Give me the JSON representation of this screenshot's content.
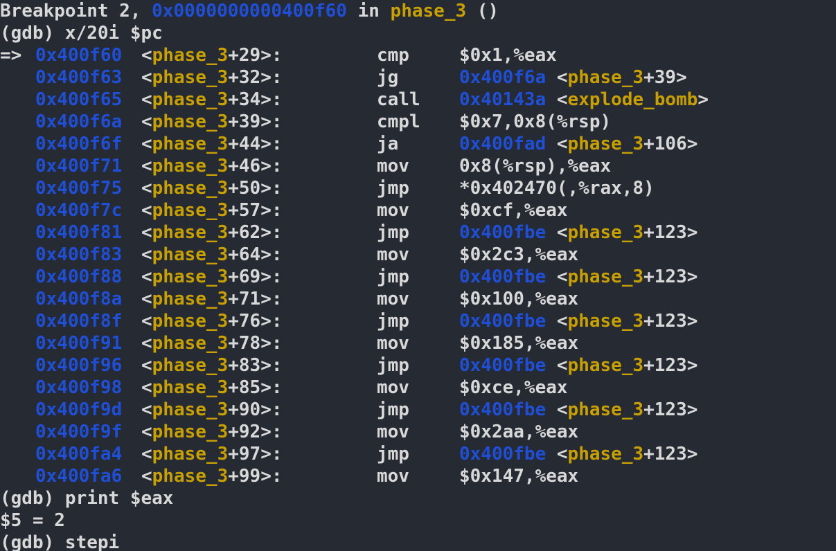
{
  "breakpoint": {
    "prefix": "Breakpoint 2, ",
    "address": "0x0000000000400f60",
    "in_text": " in ",
    "function": "phase_3",
    "suffix": " ()"
  },
  "command1": "(gdb) x/20i $pc",
  "instructions": [
    {
      "arrow": "=>",
      "addr": "0x400f60",
      "func": "phase_3",
      "offset": "+29>:",
      "op": "cmp",
      "args": [
        {
          "t": "$0x1,%eax",
          "c": "white"
        }
      ]
    },
    {
      "arrow": "",
      "addr": "0x400f63",
      "func": "phase_3",
      "offset": "+32>:",
      "op": "jg",
      "args": [
        {
          "t": "0x400f6a",
          "c": "blue"
        },
        {
          "t": " <",
          "c": "white"
        },
        {
          "t": "phase_3",
          "c": "yellow"
        },
        {
          "t": "+39>",
          "c": "white"
        }
      ]
    },
    {
      "arrow": "",
      "addr": "0x400f65",
      "func": "phase_3",
      "offset": "+34>:",
      "op": "call",
      "args": [
        {
          "t": "0x40143a",
          "c": "blue"
        },
        {
          "t": " <",
          "c": "white"
        },
        {
          "t": "explode_bomb",
          "c": "yellow"
        },
        {
          "t": ">",
          "c": "white"
        }
      ]
    },
    {
      "arrow": "",
      "addr": "0x400f6a",
      "func": "phase_3",
      "offset": "+39>:",
      "op": "cmpl",
      "args": [
        {
          "t": "$0x7,0x8(%rsp)",
          "c": "white"
        }
      ]
    },
    {
      "arrow": "",
      "addr": "0x400f6f",
      "func": "phase_3",
      "offset": "+44>:",
      "op": "ja",
      "args": [
        {
          "t": "0x400fad",
          "c": "blue"
        },
        {
          "t": " <",
          "c": "white"
        },
        {
          "t": "phase_3",
          "c": "yellow"
        },
        {
          "t": "+106>",
          "c": "white"
        }
      ]
    },
    {
      "arrow": "",
      "addr": "0x400f71",
      "func": "phase_3",
      "offset": "+46>:",
      "op": "mov",
      "args": [
        {
          "t": "0x8(%rsp),%eax",
          "c": "white"
        }
      ]
    },
    {
      "arrow": "",
      "addr": "0x400f75",
      "func": "phase_3",
      "offset": "+50>:",
      "op": "jmp",
      "args": [
        {
          "t": "*0x402470(,%rax,8)",
          "c": "white"
        }
      ]
    },
    {
      "arrow": "",
      "addr": "0x400f7c",
      "func": "phase_3",
      "offset": "+57>:",
      "op": "mov",
      "args": [
        {
          "t": "$0xcf,%eax",
          "c": "white"
        }
      ]
    },
    {
      "arrow": "",
      "addr": "0x400f81",
      "func": "phase_3",
      "offset": "+62>:",
      "op": "jmp",
      "args": [
        {
          "t": "0x400fbe",
          "c": "blue"
        },
        {
          "t": " <",
          "c": "white"
        },
        {
          "t": "phase_3",
          "c": "yellow"
        },
        {
          "t": "+123>",
          "c": "white"
        }
      ]
    },
    {
      "arrow": "",
      "addr": "0x400f83",
      "func": "phase_3",
      "offset": "+64>:",
      "op": "mov",
      "args": [
        {
          "t": "$0x2c3,%eax",
          "c": "white"
        }
      ]
    },
    {
      "arrow": "",
      "addr": "0x400f88",
      "func": "phase_3",
      "offset": "+69>:",
      "op": "jmp",
      "args": [
        {
          "t": "0x400fbe",
          "c": "blue"
        },
        {
          "t": " <",
          "c": "white"
        },
        {
          "t": "phase_3",
          "c": "yellow"
        },
        {
          "t": "+123>",
          "c": "white"
        }
      ]
    },
    {
      "arrow": "",
      "addr": "0x400f8a",
      "func": "phase_3",
      "offset": "+71>:",
      "op": "mov",
      "args": [
        {
          "t": "$0x100,%eax",
          "c": "white"
        }
      ]
    },
    {
      "arrow": "",
      "addr": "0x400f8f",
      "func": "phase_3",
      "offset": "+76>:",
      "op": "jmp",
      "args": [
        {
          "t": "0x400fbe",
          "c": "blue"
        },
        {
          "t": " <",
          "c": "white"
        },
        {
          "t": "phase_3",
          "c": "yellow"
        },
        {
          "t": "+123>",
          "c": "white"
        }
      ]
    },
    {
      "arrow": "",
      "addr": "0x400f91",
      "func": "phase_3",
      "offset": "+78>:",
      "op": "mov",
      "args": [
        {
          "t": "$0x185,%eax",
          "c": "white"
        }
      ]
    },
    {
      "arrow": "",
      "addr": "0x400f96",
      "func": "phase_3",
      "offset": "+83>:",
      "op": "jmp",
      "args": [
        {
          "t": "0x400fbe",
          "c": "blue"
        },
        {
          "t": " <",
          "c": "white"
        },
        {
          "t": "phase_3",
          "c": "yellow"
        },
        {
          "t": "+123>",
          "c": "white"
        }
      ]
    },
    {
      "arrow": "",
      "addr": "0x400f98",
      "func": "phase_3",
      "offset": "+85>:",
      "op": "mov",
      "args": [
        {
          "t": "$0xce,%eax",
          "c": "white"
        }
      ]
    },
    {
      "arrow": "",
      "addr": "0x400f9d",
      "func": "phase_3",
      "offset": "+90>:",
      "op": "jmp",
      "args": [
        {
          "t": "0x400fbe",
          "c": "blue"
        },
        {
          "t": " <",
          "c": "white"
        },
        {
          "t": "phase_3",
          "c": "yellow"
        },
        {
          "t": "+123>",
          "c": "white"
        }
      ]
    },
    {
      "arrow": "",
      "addr": "0x400f9f",
      "func": "phase_3",
      "offset": "+92>:",
      "op": "mov",
      "args": [
        {
          "t": "$0x2aa,%eax",
          "c": "white"
        }
      ]
    },
    {
      "arrow": "",
      "addr": "0x400fa4",
      "func": "phase_3",
      "offset": "+97>:",
      "op": "jmp",
      "args": [
        {
          "t": "0x400fbe",
          "c": "blue"
        },
        {
          "t": " <",
          "c": "white"
        },
        {
          "t": "phase_3",
          "c": "yellow"
        },
        {
          "t": "+123>",
          "c": "white"
        }
      ]
    },
    {
      "arrow": "",
      "addr": "0x400fa6",
      "func": "phase_3",
      "offset": "+99>:",
      "op": "mov",
      "args": [
        {
          "t": "$0x147,%eax",
          "c": "white"
        }
      ]
    }
  ],
  "command2": "(gdb) print $eax",
  "result": "$5 = 2",
  "command3": "(gdb) stepi",
  "colors": {
    "background": "#262b33",
    "text": "#d8d8d8",
    "address": "#1f4fd6",
    "symbol": "#c8a000"
  }
}
